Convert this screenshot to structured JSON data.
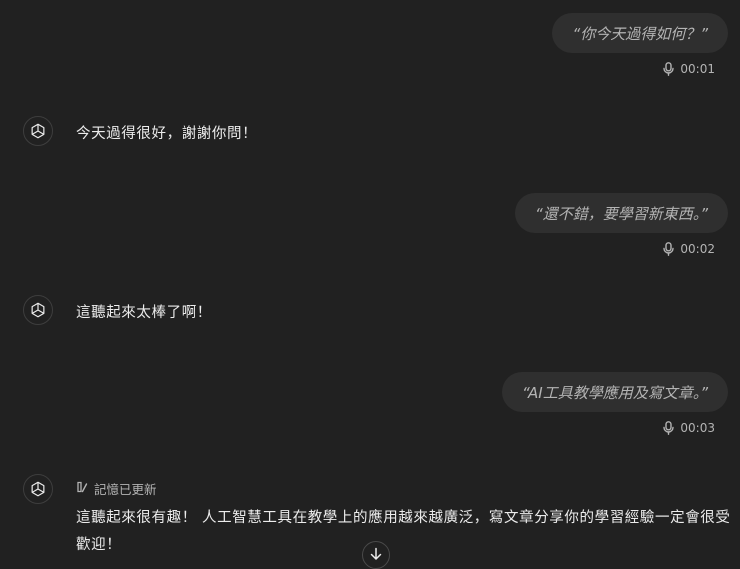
{
  "conversation": {
    "user_messages": [
      {
        "text": "“你今天過得如何？”",
        "duration": "00:01"
      },
      {
        "text": "“還不錯，要學習新東西。”",
        "duration": "00:02"
      },
      {
        "text": "“AI工具教學應用及寫文章。”",
        "duration": "00:03"
      }
    ],
    "assistant_messages": [
      {
        "text": "今天過得很好，謝謝你問！"
      },
      {
        "text": "這聽起來太棒了啊！"
      },
      {
        "memory_label": "記憶已更新",
        "text": "這聽起來很有趣！ 人工智慧工具在教學上的應用越來越廣泛，寫文章分享你的學習經驗一定會很受歡迎！"
      }
    ]
  },
  "icons": {
    "assistant_avatar": "openai-logo-icon",
    "voice": "microphone-icon",
    "memory": "memory-updated-icon",
    "scroll": "arrow-down-icon"
  },
  "colors": {
    "background": "#212121",
    "bubble": "#2f2f2f",
    "text_primary": "#ececec",
    "text_secondary": "#b4b4b4"
  }
}
